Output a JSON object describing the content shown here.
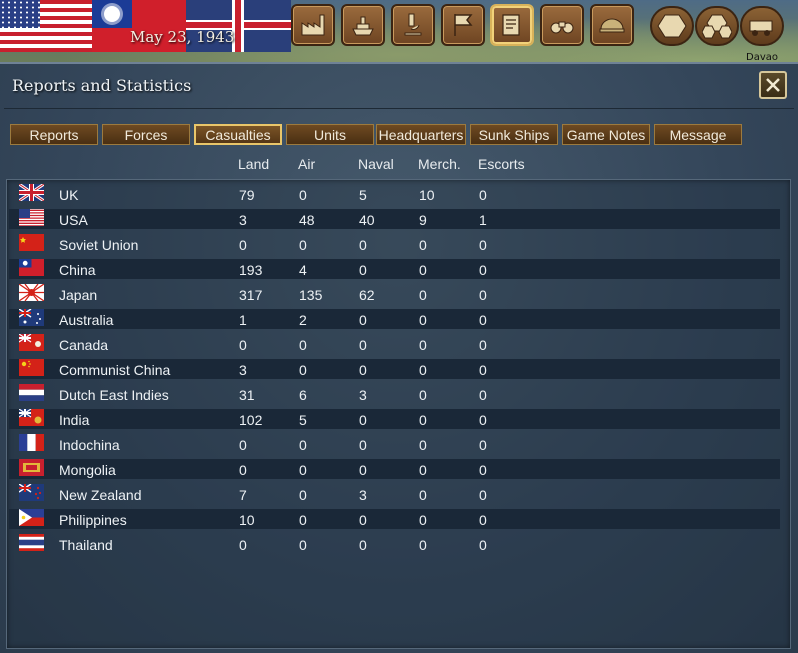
{
  "topbar": {
    "date": "May 23, 1943",
    "map_label": "Davao",
    "buttons": [
      {
        "name": "production",
        "icon": "factory-icon"
      },
      {
        "name": "naval",
        "icon": "ship-icon"
      },
      {
        "name": "research",
        "icon": "microscope-icon"
      },
      {
        "name": "diplomacy",
        "icon": "flag-icon"
      },
      {
        "name": "reports",
        "icon": "report-icon",
        "active": true
      },
      {
        "name": "intelligence",
        "icon": "binoculars-icon"
      },
      {
        "name": "units",
        "icon": "helmet-icon"
      }
    ],
    "map_buttons": [
      {
        "name": "hex-single",
        "icon": "hex-icon"
      },
      {
        "name": "hex-cluster",
        "icon": "hex-cluster-icon"
      },
      {
        "name": "hex-rail",
        "icon": "rail-icon"
      }
    ]
  },
  "panel": {
    "title": "Reports and Statistics",
    "close_icon": "close-icon"
  },
  "tabs": [
    {
      "label": "Reports"
    },
    {
      "label": "Forces"
    },
    {
      "label": "Casualties",
      "active": true
    },
    {
      "label": "Units"
    },
    {
      "label": "Headquarters"
    },
    {
      "label": "Sunk Ships"
    },
    {
      "label": "Game Notes"
    },
    {
      "label": "Message"
    }
  ],
  "table": {
    "columns": [
      "Land",
      "Air",
      "Naval",
      "Merch.",
      "Escorts"
    ],
    "rows": [
      {
        "name": "UK",
        "flag": "uk-flag-icon",
        "land": "79",
        "air": "0",
        "naval": "5",
        "merch": "10",
        "escorts": "0"
      },
      {
        "name": "USA",
        "flag": "usa-flag-icon",
        "land": "3",
        "air": "48",
        "naval": "40",
        "merch": "9",
        "escorts": "1"
      },
      {
        "name": "Soviet Union",
        "flag": "soviet-flag-icon",
        "land": "0",
        "air": "0",
        "naval": "0",
        "merch": "0",
        "escorts": "0"
      },
      {
        "name": "China",
        "flag": "china-flag-icon",
        "land": "193",
        "air": "4",
        "naval": "0",
        "merch": "0",
        "escorts": "0"
      },
      {
        "name": "Japan",
        "flag": "japan-flag-icon",
        "land": "317",
        "air": "135",
        "naval": "62",
        "merch": "0",
        "escorts": "0"
      },
      {
        "name": "Australia",
        "flag": "australia-flag-icon",
        "land": "1",
        "air": "2",
        "naval": "0",
        "merch": "0",
        "escorts": "0"
      },
      {
        "name": "Canada",
        "flag": "canada-flag-icon",
        "land": "0",
        "air": "0",
        "naval": "0",
        "merch": "0",
        "escorts": "0"
      },
      {
        "name": "Communist China",
        "flag": "communist-china-flag-icon",
        "land": "3",
        "air": "0",
        "naval": "0",
        "merch": "0",
        "escorts": "0"
      },
      {
        "name": "Dutch East Indies",
        "flag": "dutch-flag-icon",
        "land": "31",
        "air": "6",
        "naval": "3",
        "merch": "0",
        "escorts": "0"
      },
      {
        "name": "India",
        "flag": "india-flag-icon",
        "land": "102",
        "air": "5",
        "naval": "0",
        "merch": "0",
        "escorts": "0"
      },
      {
        "name": "Indochina",
        "flag": "france-flag-icon",
        "land": "0",
        "air": "0",
        "naval": "0",
        "merch": "0",
        "escorts": "0"
      },
      {
        "name": "Mongolia",
        "flag": "mongolia-flag-icon",
        "land": "0",
        "air": "0",
        "naval": "0",
        "merch": "0",
        "escorts": "0"
      },
      {
        "name": "New Zealand",
        "flag": "new-zealand-flag-icon",
        "land": "7",
        "air": "0",
        "naval": "3",
        "merch": "0",
        "escorts": "0"
      },
      {
        "name": "Philippines",
        "flag": "philippines-flag-icon",
        "land": "10",
        "air": "0",
        "naval": "0",
        "merch": "0",
        "escorts": "0"
      },
      {
        "name": "Thailand",
        "flag": "thailand-flag-icon",
        "land": "0",
        "air": "0",
        "naval": "0",
        "merch": "0",
        "escorts": "0"
      }
    ]
  }
}
